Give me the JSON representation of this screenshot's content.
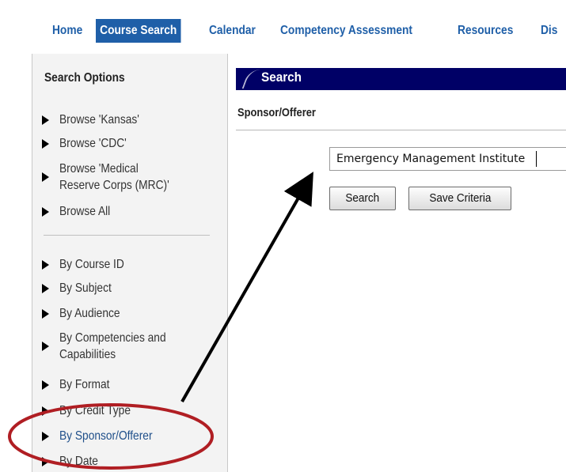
{
  "nav": {
    "items": [
      {
        "label": "Home",
        "active": false
      },
      {
        "label": "Course Search",
        "active": true
      },
      {
        "label": "Calendar",
        "active": false
      },
      {
        "label": "Competency Assessment",
        "active": false
      },
      {
        "label": "Resources",
        "active": false
      },
      {
        "label": "Dis",
        "active": false
      }
    ]
  },
  "sidebar": {
    "title": "Search Options",
    "browse_items": [
      {
        "label": "Browse 'Kansas'"
      },
      {
        "label": "Browse 'CDC'"
      },
      {
        "label_line1": "Browse 'Medical",
        "label_line2": "Reserve Corps (MRC)'"
      },
      {
        "label": "Browse All"
      }
    ],
    "by_items": [
      {
        "label": "By Course ID"
      },
      {
        "label": "By Subject"
      },
      {
        "label": "By Audience"
      },
      {
        "label_line1": "By Competencies and",
        "label_line2": "Capabilities"
      },
      {
        "label": "By Format"
      },
      {
        "label": "By Credit Type"
      },
      {
        "label": "By Sponsor/Offerer",
        "active": true
      },
      {
        "label": "By Date"
      }
    ]
  },
  "main": {
    "header_title": "Search",
    "section_label": "Sponsor/Offerer",
    "sponsor_input_value": "Emergency Management Institute",
    "search_button_label": "Search",
    "save_criteria_button_label": "Save Criteria"
  },
  "colors": {
    "nav_text": "#1f5fa8",
    "nav_active_bg": "#1f5fa8",
    "header_bar": "#000066",
    "annotation_ellipse": "#b01e23",
    "arrow": "#000000"
  }
}
